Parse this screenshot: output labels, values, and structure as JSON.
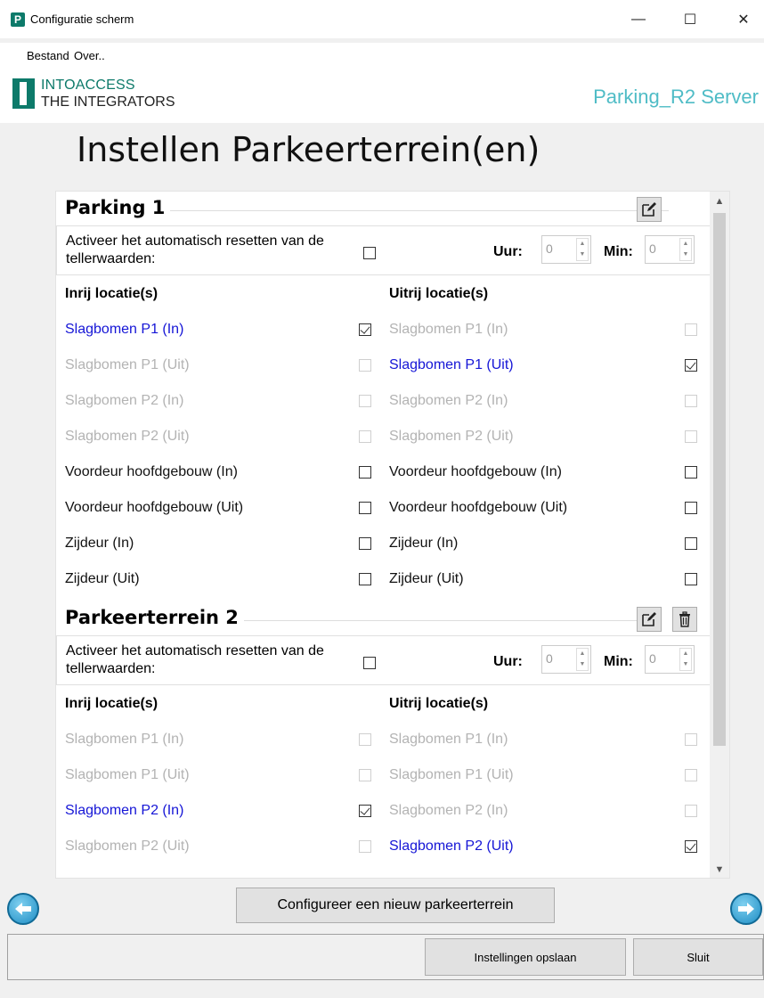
{
  "window": {
    "app_icon_letter": "P",
    "title": "Configuratie scherm",
    "minimize_symbol": "—",
    "maximize_symbol": "☐",
    "close_symbol": "✕"
  },
  "menu": {
    "items": [
      "Bestand",
      "Over.."
    ]
  },
  "header": {
    "logo_line1": "INTOACCESS",
    "logo_line2": "THE INTEGRATORS",
    "server_name": "Parking_R2 Server"
  },
  "page_title": "Instellen Parkeerterrein(en)",
  "labels": {
    "reset_label": "Activeer het automatisch resetten van de tellerwaarden:",
    "uur": "Uur:",
    "min": "Min:",
    "inrij_header": "Inrij locatie(s)",
    "uitrij_header": "Uitrij locatie(s)"
  },
  "parkings": [
    {
      "name": "Parking 1",
      "reset_checked": false,
      "uur": "0",
      "min": "0",
      "has_delete": false,
      "rows": [
        {
          "in_label": "Slagbomen P1 (In)",
          "in_state": "active",
          "in_checked": true,
          "out_label": "Slagbomen P1 (In)",
          "out_state": "disabled",
          "out_checked": false
        },
        {
          "in_label": "Slagbomen P1 (Uit)",
          "in_state": "disabled",
          "in_checked": false,
          "out_label": "Slagbomen P1 (Uit)",
          "out_state": "active",
          "out_checked": true
        },
        {
          "in_label": "Slagbomen P2 (In)",
          "in_state": "disabled",
          "in_checked": false,
          "out_label": "Slagbomen P2 (In)",
          "out_state": "disabled",
          "out_checked": false
        },
        {
          "in_label": "Slagbomen P2 (Uit)",
          "in_state": "disabled",
          "in_checked": false,
          "out_label": "Slagbomen P2 (Uit)",
          "out_state": "disabled",
          "out_checked": false
        },
        {
          "in_label": "Voordeur hoofdgebouw (In)",
          "in_state": "normal",
          "in_checked": false,
          "out_label": "Voordeur hoofdgebouw (In)",
          "out_state": "normal",
          "out_checked": false
        },
        {
          "in_label": "Voordeur hoofdgebouw (Uit)",
          "in_state": "normal",
          "in_checked": false,
          "out_label": "Voordeur hoofdgebouw (Uit)",
          "out_state": "normal",
          "out_checked": false
        },
        {
          "in_label": "Zijdeur (In)",
          "in_state": "normal",
          "in_checked": false,
          "out_label": "Zijdeur (In)",
          "out_state": "normal",
          "out_checked": false
        },
        {
          "in_label": "Zijdeur (Uit)",
          "in_state": "normal",
          "in_checked": false,
          "out_label": "Zijdeur (Uit)",
          "out_state": "normal",
          "out_checked": false
        }
      ]
    },
    {
      "name": "Parkeerterrein 2",
      "reset_checked": false,
      "uur": "0",
      "min": "0",
      "has_delete": true,
      "rows": [
        {
          "in_label": "Slagbomen P1 (In)",
          "in_state": "disabled",
          "in_checked": false,
          "out_label": "Slagbomen P1 (In)",
          "out_state": "disabled",
          "out_checked": false
        },
        {
          "in_label": "Slagbomen P1 (Uit)",
          "in_state": "disabled",
          "in_checked": false,
          "out_label": "Slagbomen P1 (Uit)",
          "out_state": "disabled",
          "out_checked": false
        },
        {
          "in_label": "Slagbomen P2 (In)",
          "in_state": "active",
          "in_checked": true,
          "out_label": "Slagbomen P2 (In)",
          "out_state": "disabled",
          "out_checked": false
        },
        {
          "in_label": "Slagbomen P2 (Uit)",
          "in_state": "disabled",
          "in_checked": false,
          "out_label": "Slagbomen P2 (Uit)",
          "out_state": "active",
          "out_checked": true
        }
      ]
    }
  ],
  "buttons": {
    "new_parking": "Configureer een nieuw parkeerterrein",
    "save": "Instellingen opslaan",
    "close": "Sluit"
  },
  "colors": {
    "brand": "#0d7a6a",
    "server_name": "#4fbcc6",
    "active_location": "#1515d6",
    "disabled_location": "#b3b3b3"
  },
  "icons": {
    "edit": "edit-icon",
    "delete": "trash-icon",
    "nav_left": "arrow-left-icon",
    "nav_right": "arrow-right-icon"
  }
}
